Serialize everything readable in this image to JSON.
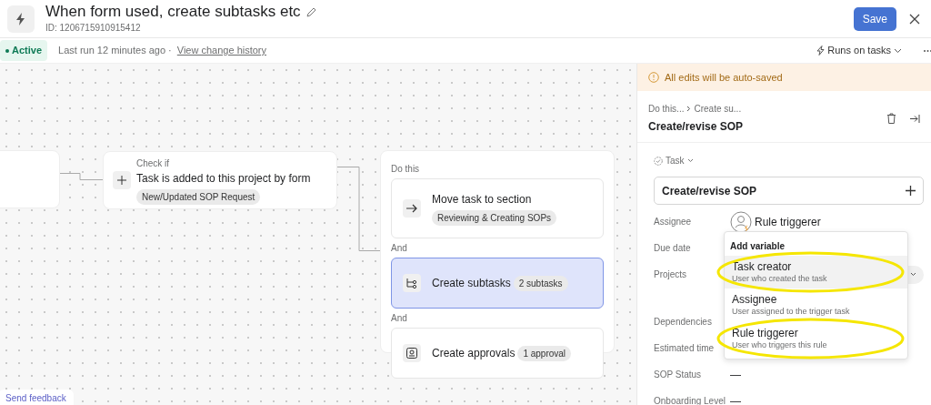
{
  "header": {
    "title": "When form used, create subtasks etc",
    "id_text": "ID: 1206715910915412",
    "save_label": "Save"
  },
  "status_bar": {
    "status": "Active",
    "active": true,
    "last_run": "Last run 12 minutes ago ·",
    "history_link": "View change history",
    "runs_on": "Runs on tasks"
  },
  "canvas": {
    "check": {
      "label": "Check if",
      "text": "Task is added to this project by form",
      "tag": "New/Updated SOP Request"
    },
    "actions_label": "Do this",
    "actions": [
      {
        "title": "Move task to section",
        "tag": "Reviewing & Creating SOPs",
        "selected": false
      },
      {
        "connector": "And",
        "title": "Create subtasks",
        "tag": "2 subtasks",
        "selected": true
      },
      {
        "connector": "And",
        "title": "Create approvals",
        "tag": "1 approval",
        "selected": false
      }
    ],
    "feedback": "Send feedback"
  },
  "panel": {
    "notice": "All edits will be auto-saved",
    "breadcrumb": [
      "Do this...",
      "Create su..."
    ],
    "title": "Create/revise SOP",
    "type_label": "Task",
    "task_name": "Create/revise SOP",
    "fields": [
      {
        "label": "Assignee",
        "value": "Rule triggerer",
        "kind": "person"
      },
      {
        "label": "Due date",
        "kind": "empty"
      },
      {
        "label": "Projects",
        "kind": "chip"
      },
      {
        "label": "Dependencies",
        "kind": "empty"
      },
      {
        "label": "Estimated time",
        "kind": "empty"
      },
      {
        "label": "SOP Status",
        "value": "—",
        "kind": "text"
      },
      {
        "label": "Onboarding Level",
        "value": "—",
        "kind": "text"
      }
    ],
    "menu": {
      "heading": "Add variable",
      "items": [
        {
          "title": "Task creator",
          "subtitle": "User who created the task",
          "selected": true,
          "highlighted": true
        },
        {
          "title": "Assignee",
          "subtitle": "User assigned to the trigger task",
          "selected": false,
          "highlighted": false
        },
        {
          "title": "Rule triggerer",
          "subtitle": "User who triggers this rule",
          "selected": false,
          "highlighted": true
        }
      ]
    }
  }
}
